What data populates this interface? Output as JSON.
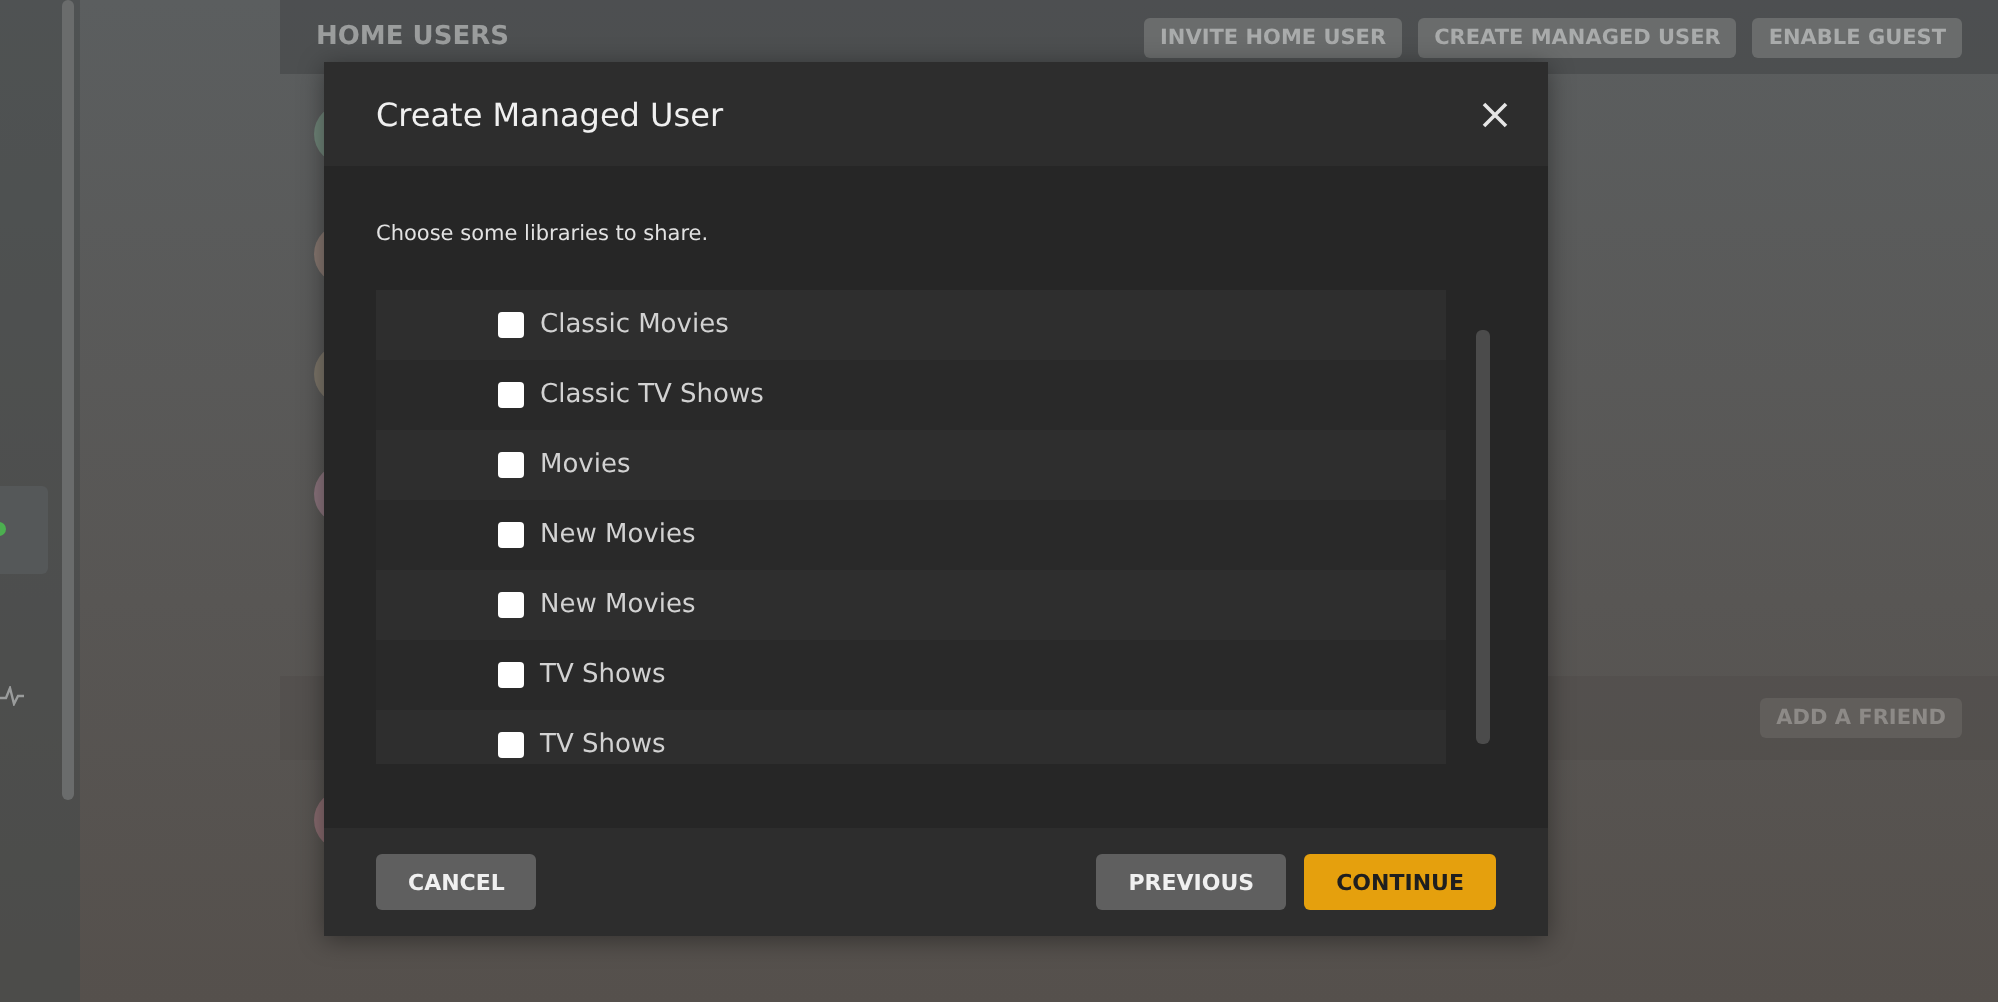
{
  "home_users": {
    "title": "HOME USERS",
    "buttons": [
      "INVITE HOME USER",
      "CREATE MANAGED USER",
      "ENABLE GUEST"
    ],
    "users": [
      {
        "color": "#6e8377"
      },
      {
        "color": "#85766f"
      },
      {
        "color": "#7b7468"
      },
      {
        "color": "#8a737c"
      }
    ]
  },
  "friends": {
    "button": "ADD A FRIEND",
    "users": [
      {
        "color": "#86696d"
      }
    ]
  },
  "dialog": {
    "title": "Create Managed User",
    "prompt": "Choose some libraries to share.",
    "libraries": [
      {
        "label": "Classic Movies",
        "checked": false
      },
      {
        "label": "Classic TV Shows",
        "checked": false
      },
      {
        "label": "Movies",
        "checked": false
      },
      {
        "label": "New Movies",
        "checked": false
      },
      {
        "label": "New Movies",
        "checked": false
      },
      {
        "label": "TV Shows",
        "checked": false
      },
      {
        "label": "TV Shows",
        "checked": false
      }
    ],
    "buttons": [
      {
        "label": "CANCEL",
        "kind": "secondary"
      },
      {
        "label": "PREVIOUS",
        "kind": "secondary"
      },
      {
        "label": "CONTINUE",
        "kind": "primary"
      }
    ]
  }
}
